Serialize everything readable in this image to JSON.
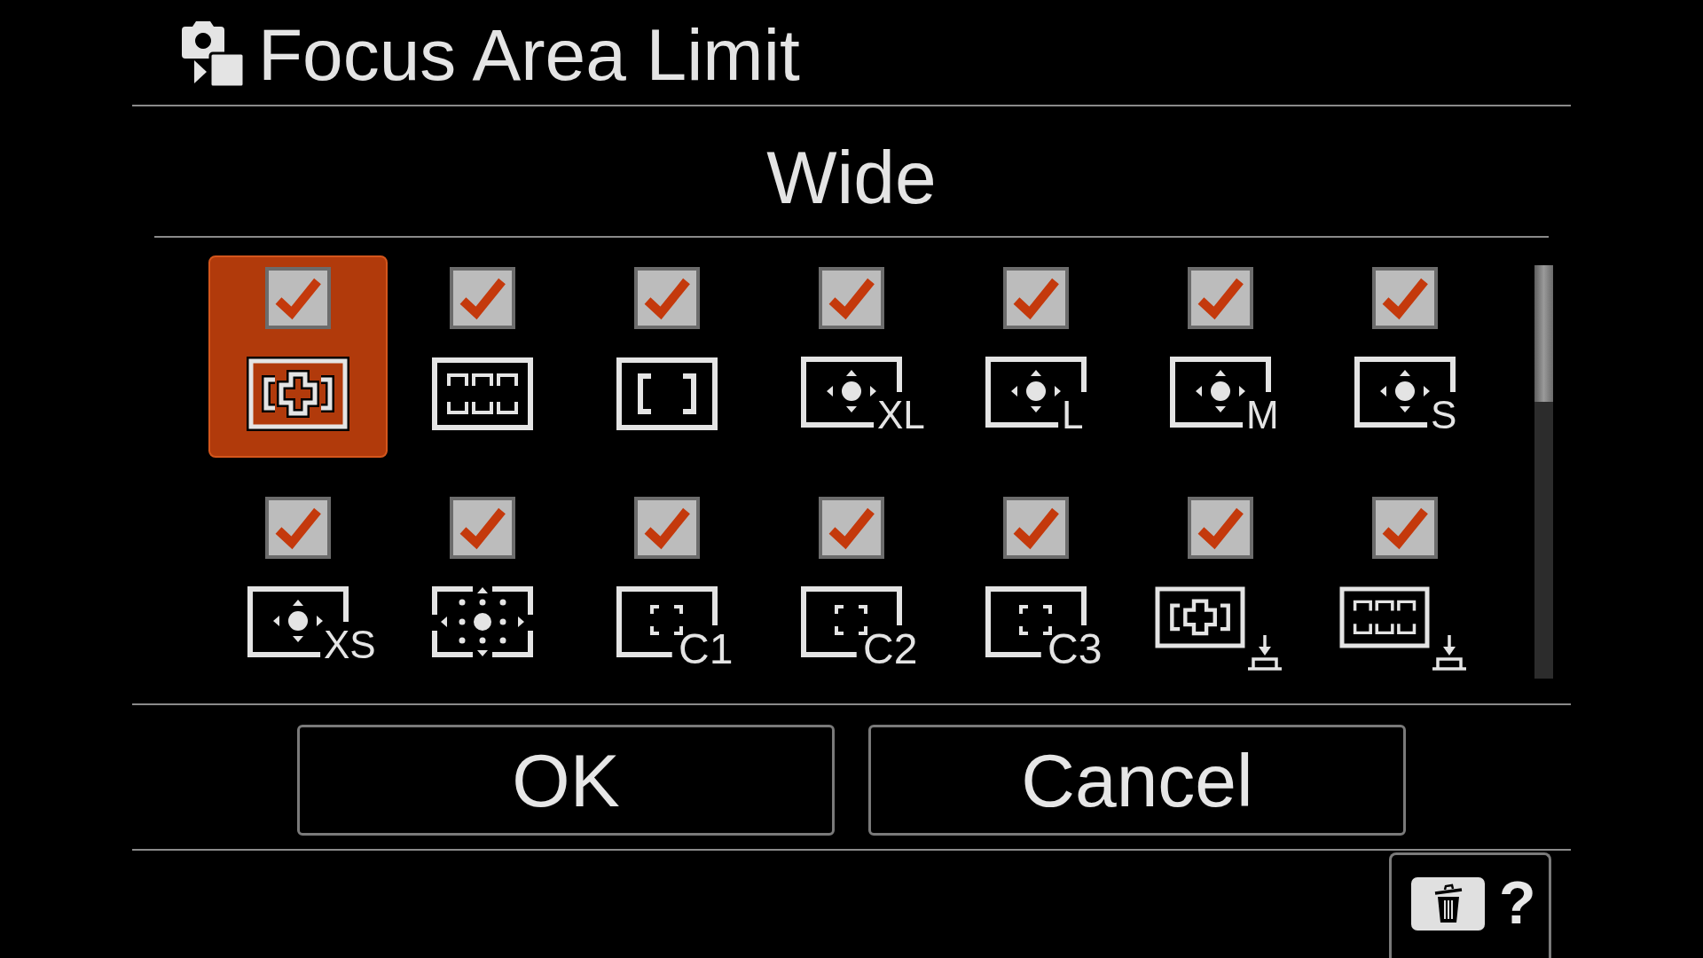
{
  "header": {
    "title": "Focus Area Limit"
  },
  "mode_title": "Wide",
  "focus_areas": [
    {
      "kind": "wide",
      "checked": true,
      "selected": true
    },
    {
      "kind": "zone",
      "checked": true,
      "selected": false
    },
    {
      "kind": "center",
      "checked": true,
      "selected": false
    },
    {
      "kind": "spot",
      "label": "XL",
      "checked": true,
      "selected": false
    },
    {
      "kind": "spot",
      "label": "L",
      "checked": true,
      "selected": false
    },
    {
      "kind": "spot",
      "label": "M",
      "checked": true,
      "selected": false
    },
    {
      "kind": "spot",
      "label": "S",
      "checked": true,
      "selected": false
    },
    {
      "kind": "spot",
      "label": "XS",
      "checked": true,
      "selected": false
    },
    {
      "kind": "expanded-spot",
      "checked": true,
      "selected": false
    },
    {
      "kind": "custom",
      "label": "C1",
      "checked": true,
      "selected": false
    },
    {
      "kind": "custom",
      "label": "C2",
      "checked": true,
      "selected": false
    },
    {
      "kind": "custom",
      "label": "C3",
      "checked": true,
      "selected": false
    },
    {
      "kind": "wide-pinned",
      "checked": true,
      "selected": false
    },
    {
      "kind": "zone-pinned",
      "checked": true,
      "selected": false
    }
  ],
  "buttons": [
    {
      "label": "OK"
    },
    {
      "label": "Cancel"
    }
  ],
  "footer_guide": {
    "label": "?"
  }
}
